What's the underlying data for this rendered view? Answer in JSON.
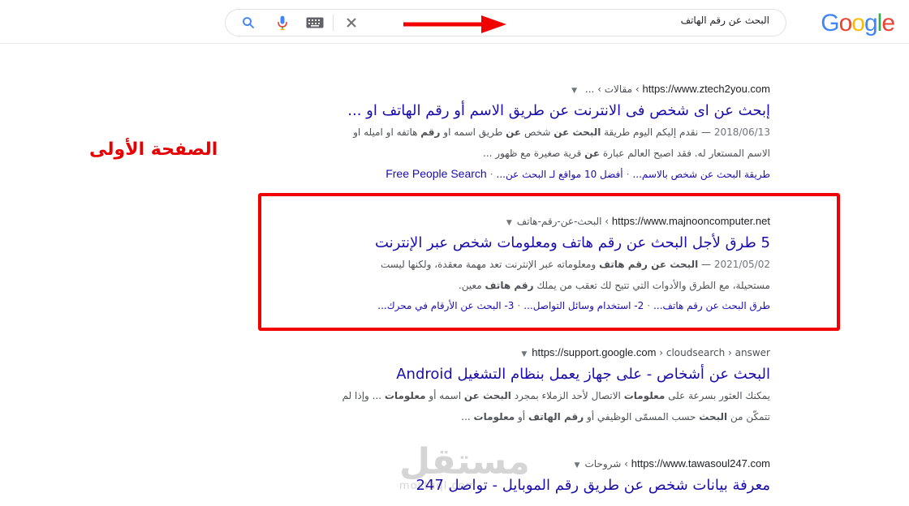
{
  "header": {
    "logo_letters": [
      "G",
      "o",
      "o",
      "g",
      "l",
      "e"
    ],
    "logo_colors": [
      "#4285F4",
      "#EA4335",
      "#FBBC05",
      "#4285F4",
      "#34A853",
      "#EA4335"
    ],
    "query": "البحث عن رقم الهاتف",
    "icons": [
      "search-icon",
      "microphone-icon",
      "keyboard-icon",
      "clear-icon"
    ]
  },
  "annotation": {
    "label": "الصفحة الأولى",
    "highlight_color": "#f20000"
  },
  "results": [
    {
      "domain": "https://www.ztech2you.com",
      "path": " › مقالات › ... ",
      "title": "إبحث عن اى شخص فى الانترنت عن طريق الاسم أو رقم الهاتف او ...",
      "date": "2018/06/13",
      "snippet_parts": [
        [
          " — نقدم إليكم اليوم طريقة ",
          false
        ],
        [
          "البحث عن",
          true
        ],
        [
          " شخص ",
          false
        ],
        [
          "عن",
          true
        ],
        [
          " طريق اسمه او ",
          false
        ],
        [
          "رقم",
          true
        ],
        [
          " هاتفه او اميله او الاسم المستعار له. فقد اصبح العالم عبارة ",
          false
        ],
        [
          "عن",
          true
        ],
        [
          " قرية صغيرة مع ظهور ...",
          false
        ]
      ],
      "links": [
        "طريقة البحث عن شخص بالاسم...",
        "أفضل 10 مواقع لـ البحث عن...",
        "Free People Search"
      ]
    },
    {
      "domain": "https://www.majnooncomputer.net",
      "path": " › البحث-عن-رقم-هاتف",
      "title": "5 طرق لأجل البحث عن رقم هاتف ومعلومات شخص عبر الإنترنت",
      "date": "2021/05/02",
      "snippet_parts": [
        [
          " — ",
          false
        ],
        [
          "البحث عن رقم هاتف",
          true
        ],
        [
          " ومعلوماته عبر الإنترنت تعد مهمة معقدة، ولكنها ليست مستحيلة، مع الطرق والأدوات التي تتيح لك تعقب من يملك ",
          false
        ],
        [
          "رقم هاتف",
          true
        ],
        [
          " معين.",
          false
        ]
      ],
      "links": [
        "طرق البحث عن رقم هاتف...",
        "2- استخدام وسائل التواصل...",
        "3- البحث عن الأرقام في محرك..."
      ]
    },
    {
      "domain": "https://support.google.com",
      "path": " › cloudsearch › answer",
      "title": "البحث عن أشخاص - على جهاز يعمل بنظام التشغيل Android",
      "date": "",
      "snippet_parts": [
        [
          "يمكنك العثور بسرعة على ",
          false
        ],
        [
          "معلومات",
          true
        ],
        [
          " الاتصال لأحد الزملاء بمجرد ",
          false
        ],
        [
          "البحث عن",
          true
        ],
        [
          " اسمه أو ",
          false
        ],
        [
          "معلومات",
          true
        ],
        [
          " ... وإذا لم تتمكّن من ",
          false
        ],
        [
          "البحث",
          true
        ],
        [
          " حسب المسمّى الوظيفي أو ",
          false
        ],
        [
          "رقم الهاتف",
          true
        ],
        [
          " أو ",
          false
        ],
        [
          "معلومات",
          true
        ],
        [
          " ...",
          false
        ]
      ],
      "links": []
    },
    {
      "domain": "https://www.tawasoul247.com",
      "path": " › شروحات",
      "title": "معرفة بيانات شخص عن طريق رقم الموبايل - تواصل 247",
      "date": "",
      "snippet_parts": [],
      "links": []
    }
  ],
  "watermark": {
    "big": "مستقل",
    "small": "mostaql.com"
  }
}
